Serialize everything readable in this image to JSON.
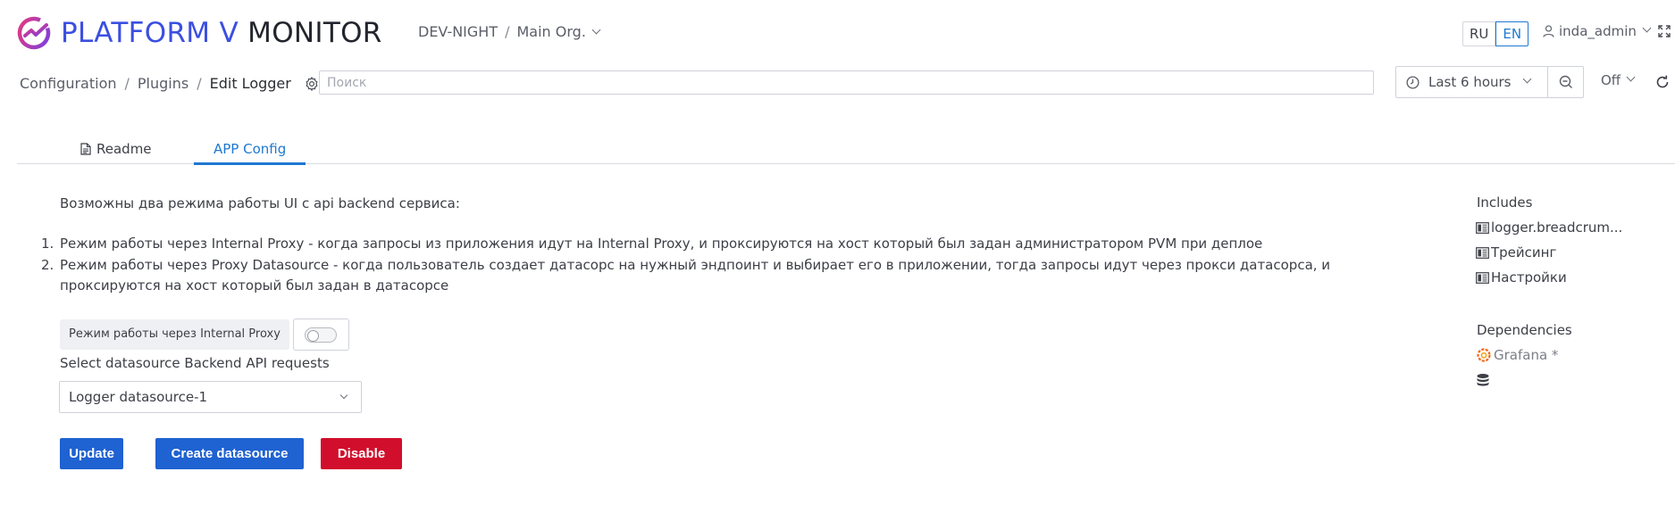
{
  "header": {
    "logo_word1": "PLATFORM V",
    "logo_word2": "MONITOR",
    "environment": "DEV-NIGHT",
    "separator": "/",
    "organization": "Main Org.",
    "lang_ru": "RU",
    "lang_en": "EN",
    "username": "inda_admin"
  },
  "breadcrumb": {
    "items": [
      "Configuration",
      "Plugins",
      "Edit Logger"
    ],
    "separator": "/"
  },
  "search": {
    "placeholder": "Поиск",
    "value": ""
  },
  "time_picker": {
    "range": "Last 6 hours"
  },
  "refresh": {
    "interval": "Off"
  },
  "tabs": [
    {
      "label": "Readme",
      "active": false
    },
    {
      "label": "APP Config",
      "active": true
    }
  ],
  "content": {
    "intro": "Возможны два режима работы UI с api backend сервиса:",
    "modes": [
      {
        "num": "1.",
        "text": "Режим работы через Internal Proxy - когда запросы из приложения идут на Internal Proxy, и проксируются на хост который был задан администратором PVM при деплое"
      },
      {
        "num": "2.",
        "text": "Режим работы через Proxy Datasource - когда пользователь создает датасорс на нужный эндпоинт и выбирает его в приложении, тогда запросы идут через прокси датасорса, и проксируются на хост который был задан в датасорсе"
      }
    ],
    "toggle_label": "Режим работы через Internal Proxy",
    "toggle_on": false,
    "datasource_label": "Select datasource Backend API requests",
    "datasource_selected": "Logger datasource-1",
    "buttons": {
      "update": "Update",
      "create_datasource": "Create datasource",
      "disable": "Disable"
    }
  },
  "sidebar": {
    "includes_title": "Includes",
    "includes": [
      "logger.breadcrum...",
      "Трейсинг",
      "Настройки"
    ],
    "dependencies_title": "Dependencies",
    "dependencies": [
      "Grafana *"
    ]
  },
  "colors": {
    "brand_blue": "#3b4fe0",
    "accent_blue": "#1f78d1",
    "button_blue": "#1f62d1",
    "danger_red": "#d10e2b"
  },
  "icons": [
    "platform-logo-icon",
    "chevron-down-icon",
    "user-icon",
    "fullscreen-icon",
    "gear-icon",
    "clock-icon",
    "zoom-out-icon",
    "refresh-icon",
    "document-icon",
    "dashboard-icon",
    "grafana-icon",
    "database-icon"
  ]
}
